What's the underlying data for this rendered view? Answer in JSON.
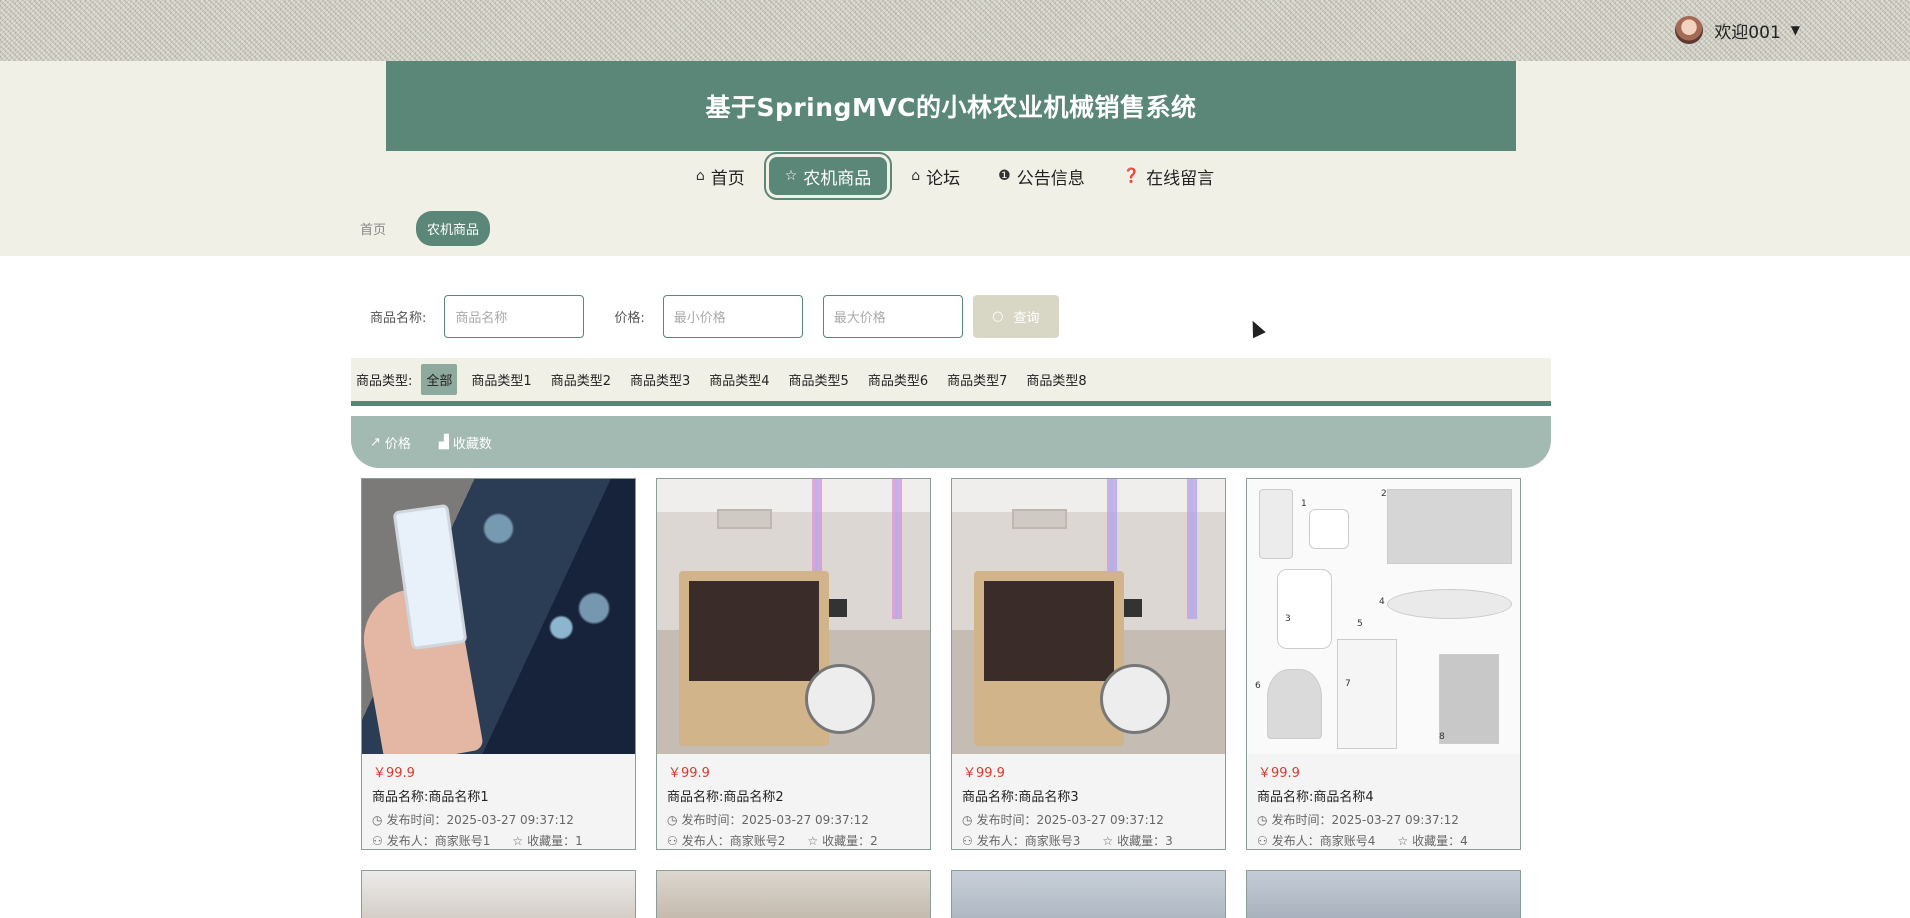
{
  "header": {
    "title": "基于SpringMVC的小林农业机械销售系统",
    "user_welcome": "欢迎001"
  },
  "nav": {
    "items": [
      {
        "label": "首页",
        "icon": "home-icon"
      },
      {
        "label": "农机商品",
        "icon": "star-icon"
      },
      {
        "label": "论坛",
        "icon": "lock-icon"
      },
      {
        "label": "公告信息",
        "icon": "info-icon"
      },
      {
        "label": "在线留言",
        "icon": "help-icon"
      }
    ],
    "active_index": 1
  },
  "breadcrumb": {
    "home": "首页",
    "current": "农机商品"
  },
  "search": {
    "name_label": "商品名称:",
    "name_placeholder": "商品名称",
    "price_label": "价格:",
    "min_placeholder": "最小价格",
    "max_placeholder": "最大价格",
    "button_label": "查询"
  },
  "categories": {
    "label": "商品类型:",
    "items": [
      "全部",
      "商品类型1",
      "商品类型2",
      "商品类型3",
      "商品类型4",
      "商品类型5",
      "商品类型6",
      "商品类型7",
      "商品类型8"
    ],
    "active_index": 0
  },
  "sort": {
    "price_label": "价格",
    "favorites_label": "收藏数"
  },
  "products": [
    {
      "price": "￥99.9",
      "name": "商品名称:商品名称1",
      "time": "发布时间：2025-03-27 09:37:12",
      "publisher": "发布人：商家账号1",
      "favorites": "收藏量：1"
    },
    {
      "price": "￥99.9",
      "name": "商品名称:商品名称2",
      "time": "发布时间：2025-03-27 09:37:12",
      "publisher": "发布人：商家账号2",
      "favorites": "收藏量：2"
    },
    {
      "price": "￥99.9",
      "name": "商品名称:商品名称3",
      "time": "发布时间：2025-03-27 09:37:12",
      "publisher": "发布人：商家账号3",
      "favorites": "收藏量：3"
    },
    {
      "price": "￥99.9",
      "name": "商品名称:商品名称4",
      "time": "发布时间：2025-03-27 09:37:12",
      "publisher": "发布人：商家账号4",
      "favorites": "收藏量：4"
    }
  ],
  "device_labels": [
    "1",
    "2",
    "3",
    "4",
    "5",
    "6",
    "7",
    "8"
  ],
  "colors": {
    "primary": "#5a8778",
    "header_bg": "#f1f0e6",
    "sort_bar": "#a2bab1",
    "price": "#d43c2e",
    "search_button": "#d8d7c6"
  }
}
